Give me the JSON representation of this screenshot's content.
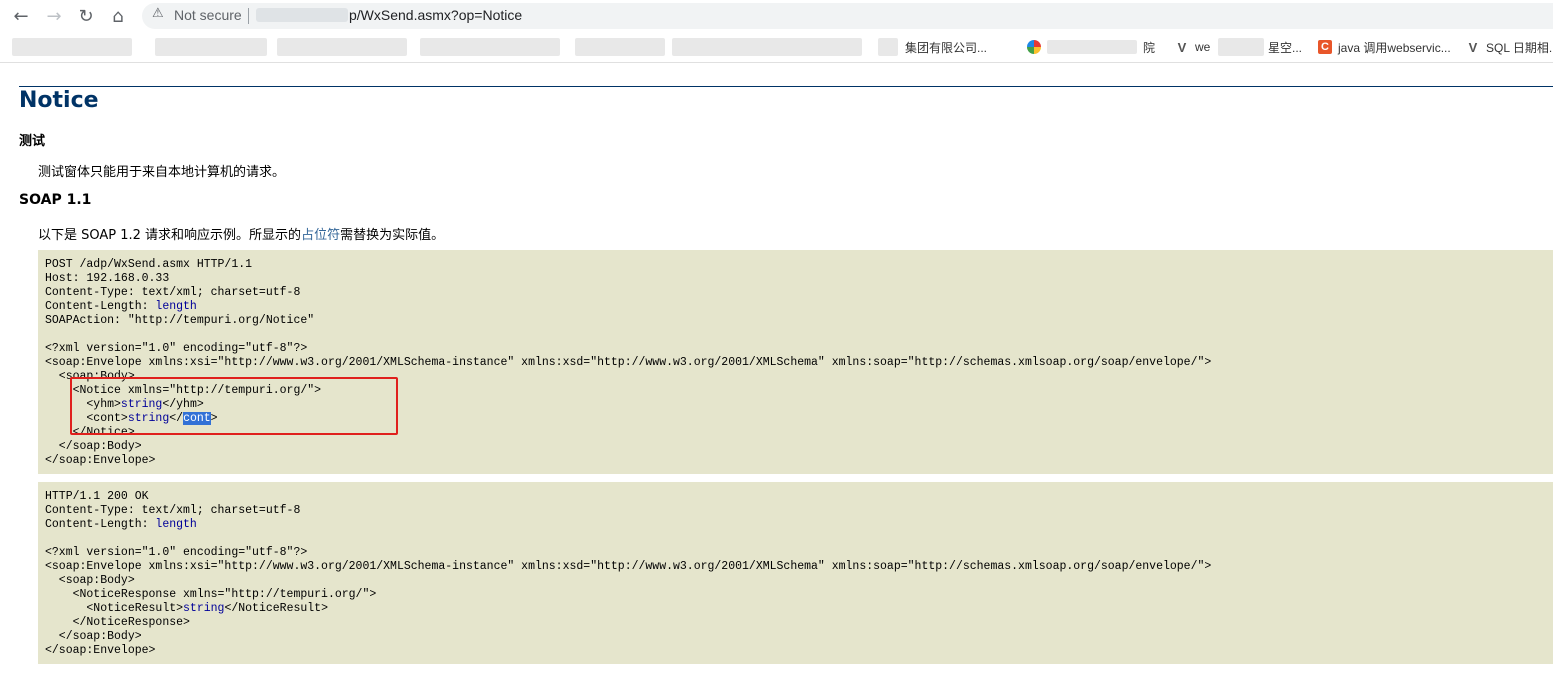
{
  "browser": {
    "security_text": "Not secure",
    "url_visible": "p/WxSend.asmx?op=Notice",
    "bookmarks": [
      "集团有限公司...",
      "院",
      "we",
      "星空...",
      "java 调用webservic...",
      "SQL 日期相..."
    ]
  },
  "page": {
    "title": "Notice",
    "test_heading": "测试",
    "test_note": "测试窗体只能用于来自本地计算机的请求。",
    "soap_heading": "SOAP 1.1",
    "intro_prefix": "以下是 SOAP 1.2 请求和响应示例。所显示的",
    "intro_link": "占位符",
    "intro_suffix": "需替换为实际值。",
    "request": {
      "l1": "POST /adp/WxSend.asmx HTTP/1.1",
      "l2": "Host: 192.168.0.33",
      "l3": "Content-Type: text/xml; charset=utf-8",
      "l4_label": "Content-Length: ",
      "l4_val": "length",
      "l5": "SOAPAction: \"http://tempuri.org/Notice\"",
      "l7": "<?xml version=\"1.0\" encoding=\"utf-8\"?>",
      "l8": "<soap:Envelope xmlns:xsi=\"http://www.w3.org/2001/XMLSchema-instance\" xmlns:xsd=\"http://www.w3.org/2001/XMLSchema\" xmlns:soap=\"http://schemas.xmlsoap.org/soap/envelope/\">",
      "l9": "  <soap:Body>",
      "l10": "    <Notice xmlns=\"http://tempuri.org/\">",
      "l11_open": "      <yhm>",
      "l11_val": "string",
      "l11_close": "</yhm>",
      "l12_open": "      <cont>",
      "l12_val": "string",
      "l12_close_a": "</",
      "l12_close_sel": "cont",
      "l12_close_b": ">",
      "l13": "    </Notice>",
      "l14": "  </soap:Body>",
      "l15": "</soap:Envelope>"
    },
    "response": {
      "l1": "HTTP/1.1 200 OK",
      "l2": "Content-Type: text/xml; charset=utf-8",
      "l3_label": "Content-Length: ",
      "l3_val": "length",
      "l5": "<?xml version=\"1.0\" encoding=\"utf-8\"?>",
      "l6": "<soap:Envelope xmlns:xsi=\"http://www.w3.org/2001/XMLSchema-instance\" xmlns:xsd=\"http://www.w3.org/2001/XMLSchema\" xmlns:soap=\"http://schemas.xmlsoap.org/soap/envelope/\">",
      "l7": "  <soap:Body>",
      "l8": "    <NoticeResponse xmlns=\"http://tempuri.org/\">",
      "l9_open": "      <NoticeResult>",
      "l9_val": "string",
      "l9_close": "</NoticeResult>",
      "l10": "    </NoticeResponse>",
      "l11": "  </soap:Body>",
      "l12": "</soap:Envelope>"
    }
  },
  "colors": {
    "title": "#003366",
    "placeholder": "#000099",
    "code_bg": "#e5e5cc",
    "annotation_border": "#e0201c",
    "selection": "#3271d6"
  }
}
